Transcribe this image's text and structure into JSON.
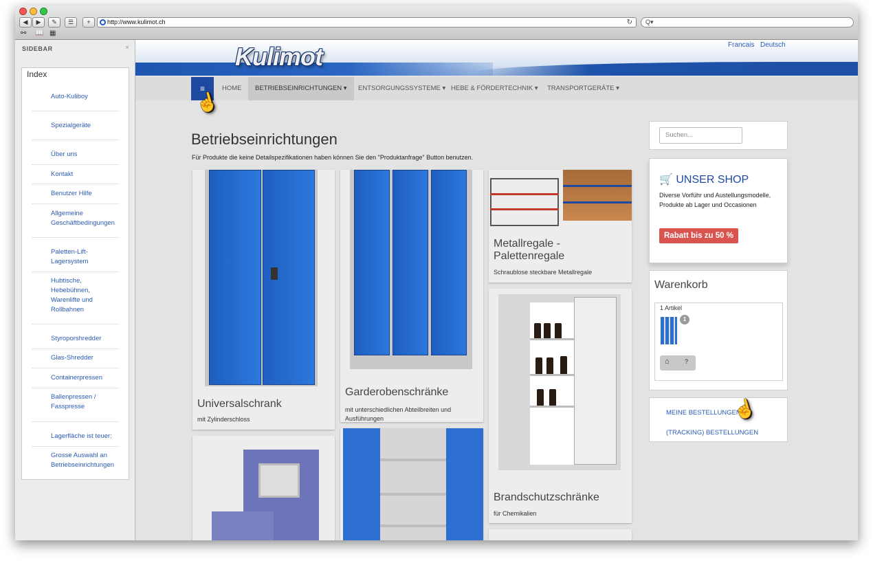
{
  "browser": {
    "url": "http://www.kulimot.ch",
    "search_placeholder": "Q▾",
    "back": "◀",
    "forward": "▶",
    "add_tab": "+",
    "reload": "↻",
    "traffic_light_colors": [
      "#fc5753",
      "#fdbc40",
      "#33c748"
    ]
  },
  "sidebar": {
    "title": "SIDEBAR",
    "close": "×",
    "index_label": "Index",
    "items": [
      "Auto-Kuliboy",
      "Spezialgeräte",
      "Über uns",
      "Kontakt",
      "Benutzer Hilfe",
      "Allgemeine Geschäftbedingungen",
      "Paletten-Lift-Lagersystem",
      "Hubtische, Hebebühnen, Warenlifte und Rollbahnen",
      "Styroporshredder",
      "Glas-Shredder",
      "Containerpressen",
      "Ballenpressen / Fasspresse",
      "Lagerfläche ist teuer:",
      "Grosse Auswahl an Betriebseinrichtungen"
    ]
  },
  "site": {
    "logo": "Kulimot",
    "languages": [
      "Francais",
      "Deutsch"
    ],
    "brand_color": "#1d49a0"
  },
  "nav": {
    "menu_icon": "≡",
    "items": [
      "HOME",
      "BETRIEBSEINRICHTUNGEN ▾",
      "ENTSORGUNGSSYSTEME ▾",
      "HEBE & FÖRDERTECHNIK ▾",
      "TRANSPORTGERÄTE ▾"
    ]
  },
  "main": {
    "title": "Betriebseinrichtungen",
    "subtitle": "Für Produkte die keine Detailspezifikationen haben können  Sie den \"Produktanfrage\" Button benutzen.",
    "products": [
      {
        "title": "Universalschrank",
        "desc": "mit Zylinderschloss"
      },
      {
        "title": "Garderobenschränke",
        "desc": "mit unterschiedlichen Abteilbreiten und Ausführungen"
      },
      {
        "title": "Metallregale - Palettenregale",
        "desc": "Schraublose steckbare Metallregale"
      },
      {
        "title": "Brandschutzschränke",
        "desc": "für Chemikalien"
      }
    ]
  },
  "right": {
    "search_placeholder": "Suchen...",
    "shop": {
      "icon": "cart-icon",
      "cart_glyph": "🛒",
      "title": "UNSER SHOP",
      "text": "Diverse Vorführ und Austellungsmodelle, Produkte ab Lager und Occasionen",
      "badge": "Rabatt bis zu 50 %",
      "badge_color": "#d9534f"
    },
    "cart": {
      "title": "Warenkorb",
      "count_label": "1 Artikel",
      "badge": "1",
      "basket_glyph": "⌂",
      "help": "?"
    },
    "orders": [
      "MEINE BESTELLUNGEN",
      "(TRACKING) BESTELLUNGEN"
    ]
  }
}
